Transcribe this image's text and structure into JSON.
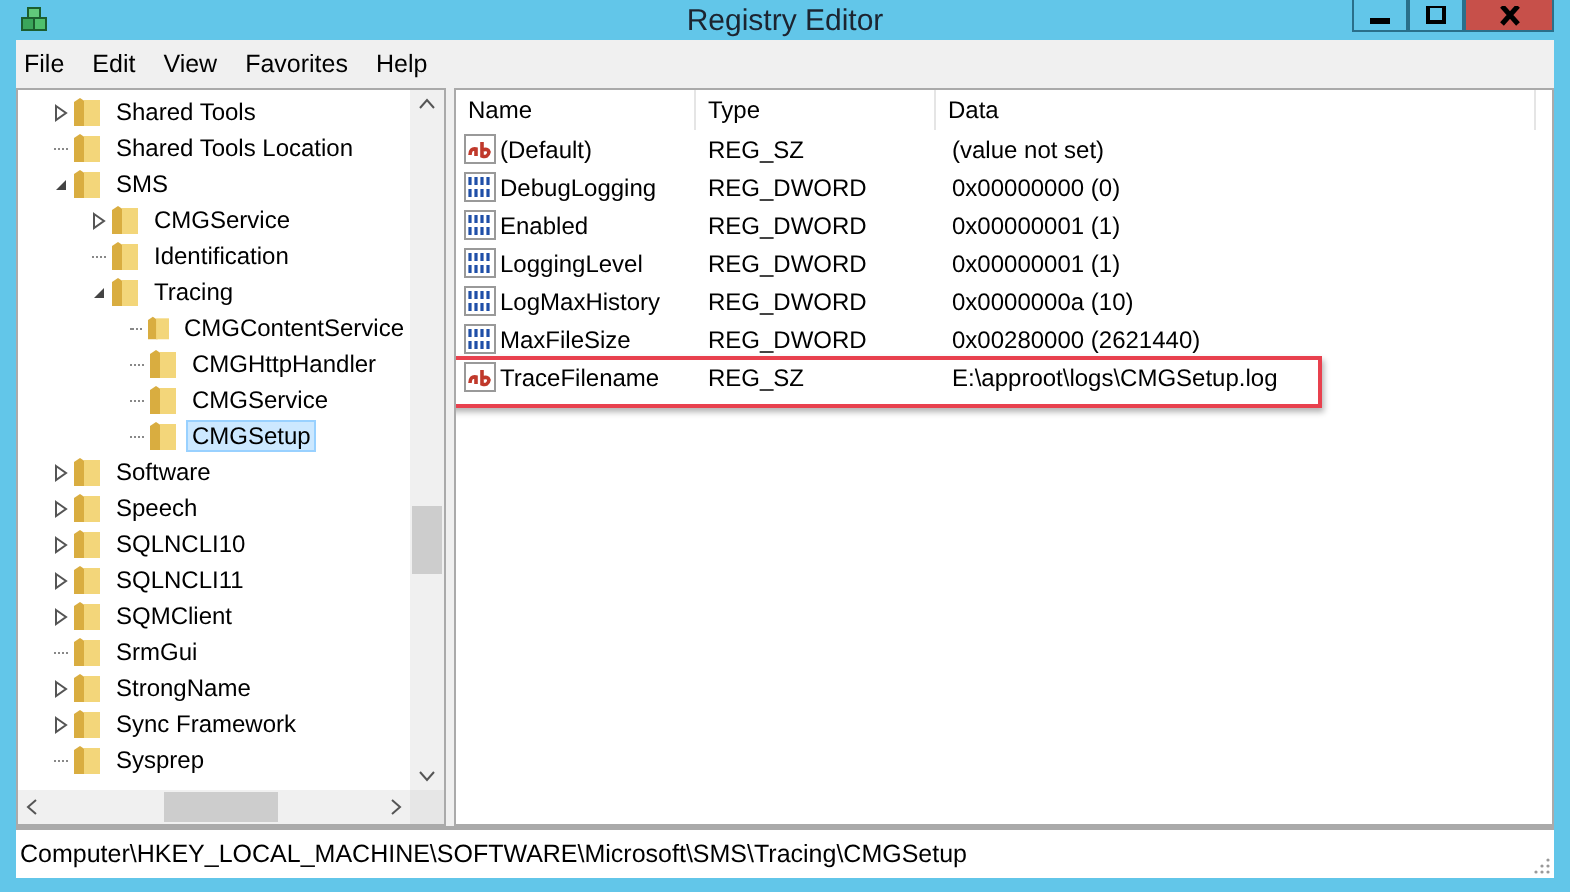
{
  "window": {
    "title": "Registry Editor"
  },
  "menu": [
    "File",
    "Edit",
    "View",
    "Favorites",
    "Help"
  ],
  "tree": [
    {
      "kind": "branch",
      "label": "Shared Tools",
      "expanded": false,
      "selected": false
    },
    {
      "kind": "leaf",
      "label": "Shared Tools Location",
      "selected": false
    },
    {
      "kind": "branch",
      "label": "SMS",
      "expanded": true,
      "selected": false,
      "children": [
        {
          "kind": "branch",
          "label": "CMGService",
          "expanded": false,
          "selected": false
        },
        {
          "kind": "leaf",
          "label": "Identification",
          "selected": false
        },
        {
          "kind": "branch",
          "label": "Tracing",
          "expanded": true,
          "selected": false,
          "children": [
            {
              "kind": "leaf",
              "label": "CMGContentService",
              "selected": false
            },
            {
              "kind": "leaf",
              "label": "CMGHttpHandler",
              "selected": false
            },
            {
              "kind": "leaf",
              "label": "CMGService",
              "selected": false
            },
            {
              "kind": "leaf",
              "label": "CMGSetup",
              "selected": true
            }
          ]
        }
      ]
    },
    {
      "kind": "branch",
      "label": "Software",
      "expanded": false,
      "selected": false
    },
    {
      "kind": "branch",
      "label": "Speech",
      "expanded": false,
      "selected": false
    },
    {
      "kind": "branch",
      "label": "SQLNCLI10",
      "expanded": false,
      "selected": false
    },
    {
      "kind": "branch",
      "label": "SQLNCLI11",
      "expanded": false,
      "selected": false
    },
    {
      "kind": "branch",
      "label": "SQMClient",
      "expanded": false,
      "selected": false
    },
    {
      "kind": "leaf",
      "label": "SrmGui",
      "selected": false
    },
    {
      "kind": "branch",
      "label": "StrongName",
      "expanded": false,
      "selected": false
    },
    {
      "kind": "branch",
      "label": "Sync Framework",
      "expanded": false,
      "selected": false
    },
    {
      "kind": "leaf",
      "label": "Sysprep",
      "selected": false
    }
  ],
  "table": {
    "columns": [
      "Name",
      "Type",
      "Data"
    ],
    "rows": [
      {
        "kind": "string",
        "name": "(Default)",
        "type": "REG_SZ",
        "data": "(value not set)",
        "highlighted": false
      },
      {
        "kind": "dword",
        "name": "DebugLogging",
        "type": "REG_DWORD",
        "data": "0x00000000 (0)",
        "highlighted": false
      },
      {
        "kind": "dword",
        "name": "Enabled",
        "type": "REG_DWORD",
        "data": "0x00000001 (1)",
        "highlighted": false
      },
      {
        "kind": "dword",
        "name": "LoggingLevel",
        "type": "REG_DWORD",
        "data": "0x00000001 (1)",
        "highlighted": false
      },
      {
        "kind": "dword",
        "name": "LogMaxHistory",
        "type": "REG_DWORD",
        "data": "0x0000000a (10)",
        "highlighted": false
      },
      {
        "kind": "dword",
        "name": "MaxFileSize",
        "type": "REG_DWORD",
        "data": "0x00280000 (2621440)",
        "highlighted": false
      },
      {
        "kind": "string",
        "name": "TraceFilename",
        "type": "REG_SZ",
        "data": "E:\\approot\\logs\\CMGSetup.log",
        "highlighted": true
      }
    ]
  },
  "status_bar": "Computer\\HKEY_LOCAL_MACHINE\\SOFTWARE\\Microsoft\\SMS\\Tracing\\CMGSetup"
}
